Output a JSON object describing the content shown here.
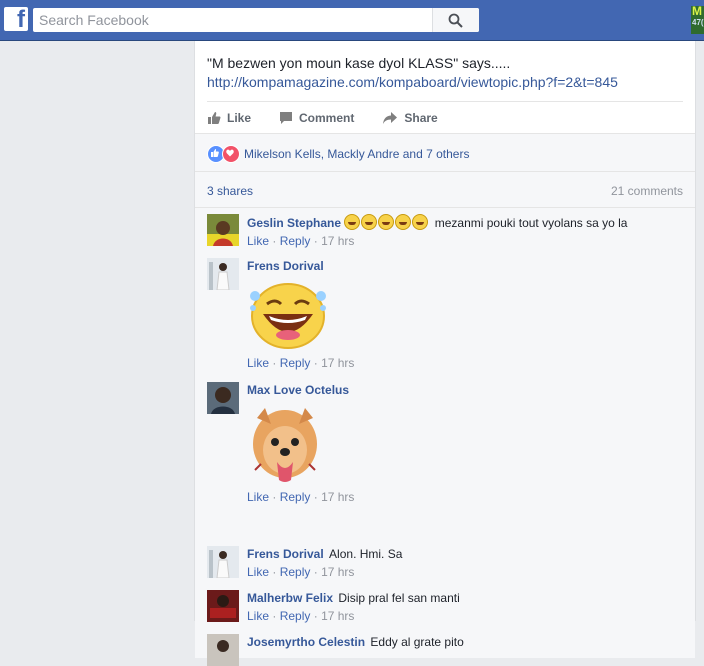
{
  "topbar": {
    "search_placeholder": "Search Facebook",
    "corner_badge_line1": "M",
    "corner_badge_line2": "47("
  },
  "post": {
    "text": "\"M bezwen yon moun kase dyol KLASS\" says.....",
    "link": "http://kompamagazine.com/kompaboard/viewtopic.php?f=2&t=845",
    "actions": {
      "like": "Like",
      "comment": "Comment",
      "share": "Share"
    },
    "reactions_text": "Mikelson Kells, Mackly Andre and 7 others",
    "shares": "3 shares",
    "comments_count": "21 comments"
  },
  "comments": [
    {
      "author": "Geslin Stephane",
      "emoji_count": 5,
      "text": "mezanmi pouki tout vyolans sa yo la",
      "like": "Like",
      "reply": "Reply",
      "sep": "·",
      "time": "17 hrs"
    },
    {
      "author": "Frens Dorival",
      "text": "",
      "sticker": "laughing-tears-sticker",
      "like": "Like",
      "reply": "Reply",
      "sep": "·",
      "time": "17 hrs"
    },
    {
      "author": "Max Love Octelus",
      "text": "",
      "sticker": "pomeranian-dog-sticker",
      "like": "Like",
      "reply": "Reply",
      "sep": "·",
      "time": "17 hrs"
    },
    {
      "author": "Frens Dorival",
      "text": "Alon. Hmi. Sa",
      "like": "Like",
      "reply": "Reply",
      "sep": "·",
      "time": "17 hrs"
    },
    {
      "author": "Malherbw Felix",
      "text": "Disip pral fel san manti",
      "like": "Like",
      "reply": "Reply",
      "sep": "·",
      "time": "17 hrs"
    },
    {
      "author": "Josemyrtho Celestin",
      "text": "Eddy al grate pito"
    }
  ],
  "colors": {
    "brand": "#4267b2",
    "link": "#365899",
    "muted": "#90949c"
  }
}
